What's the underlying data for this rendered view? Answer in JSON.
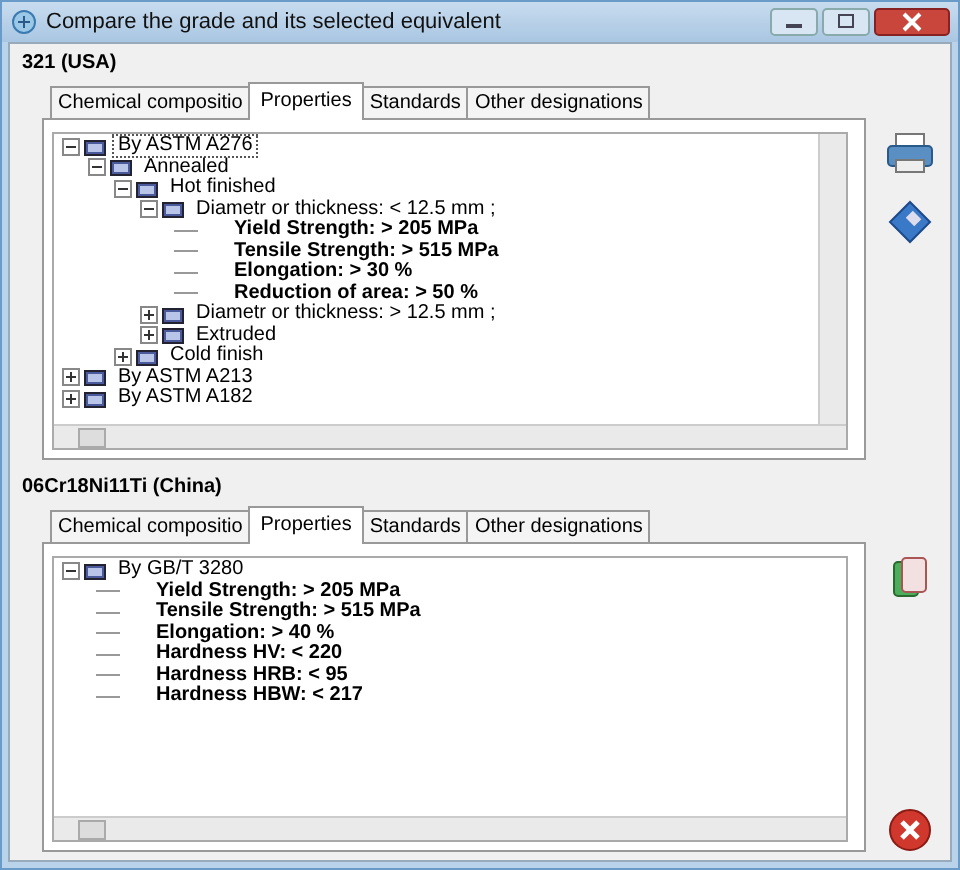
{
  "window": {
    "title": "Compare the grade and its selected equivalent"
  },
  "panels": [
    {
      "heading": "321 (USA)",
      "tabs": [
        {
          "label": "Chemical compositio",
          "selected": false
        },
        {
          "label": "Properties",
          "selected": true
        },
        {
          "label": "Standards",
          "selected": false
        },
        {
          "label": "Other designations",
          "selected": false
        }
      ],
      "tree": [
        {
          "kind": "folder",
          "label": "By ASTM A276",
          "expanded": true,
          "selected": true,
          "children": [
            {
              "kind": "folder",
              "label": "Annealed",
              "expanded": true,
              "selected": false,
              "children": [
                {
                  "kind": "folder",
                  "label": "Hot finished",
                  "expanded": true,
                  "selected": false,
                  "children": [
                    {
                      "kind": "folder",
                      "label": "Diametr or thickness: < 12.5 mm ;",
                      "expanded": true,
                      "selected": false,
                      "children": [
                        {
                          "kind": "property",
                          "label": "Yield Strength: > 205 MPa"
                        },
                        {
                          "kind": "property",
                          "label": "Tensile Strength: > 515 MPa"
                        },
                        {
                          "kind": "property",
                          "label": "Elongation: > 30 %"
                        },
                        {
                          "kind": "property",
                          "label": "Reduction of area: > 50 %"
                        }
                      ]
                    },
                    {
                      "kind": "folder",
                      "label": "Diametr or thickness: > 12.5 mm ;",
                      "expanded": false,
                      "selected": false
                    },
                    {
                      "kind": "folder",
                      "label": "Extruded",
                      "expanded": false,
                      "selected": false
                    }
                  ]
                },
                {
                  "kind": "folder",
                  "label": "Cold finish",
                  "expanded": false,
                  "selected": false
                }
              ]
            }
          ]
        },
        {
          "kind": "folder",
          "label": "By ASTM A213",
          "expanded": false,
          "selected": false
        },
        {
          "kind": "folder",
          "label": "By ASTM A182",
          "expanded": false,
          "selected": false
        }
      ]
    },
    {
      "heading": "06Cr18Ni11Ti (China)",
      "tabs": [
        {
          "label": "Chemical compositio",
          "selected": false
        },
        {
          "label": "Properties",
          "selected": true
        },
        {
          "label": "Standards",
          "selected": false
        },
        {
          "label": "Other designations",
          "selected": false
        }
      ],
      "tree": [
        {
          "kind": "folder",
          "label": "By GB/T 3280",
          "expanded": true,
          "selected": false,
          "children": [
            {
              "kind": "property",
              "label": "Yield Strength: > 205 MPa"
            },
            {
              "kind": "property",
              "label": "Tensile Strength: > 515 MPa"
            },
            {
              "kind": "property",
              "label": "Elongation: > 40 %"
            },
            {
              "kind": "property",
              "label": "Hardness HV: < 220"
            },
            {
              "kind": "property",
              "label": "Hardness HRB: < 95"
            },
            {
              "kind": "property",
              "label": "Hardness HBW: < 217"
            }
          ]
        }
      ]
    }
  ]
}
